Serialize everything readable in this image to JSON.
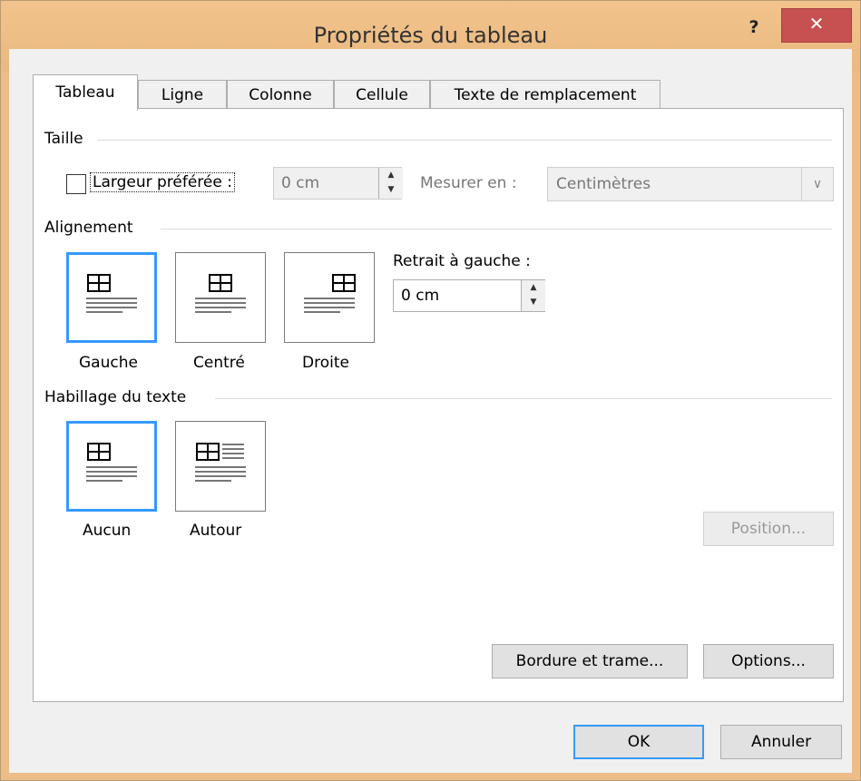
{
  "title": "Propriétés du tableau",
  "help_glyph": "?",
  "close_glyph": "✕",
  "tabs": [
    "Tableau",
    "Ligne",
    "Colonne",
    "Cellule",
    "Texte de remplacement"
  ],
  "taille": {
    "section": "Taille",
    "pref_width_label": "Largeur préférée :",
    "pref_width_value": "0 cm",
    "measure_label": "Mesurer en :",
    "measure_value": "Centimètres"
  },
  "alignement": {
    "section": "Alignement",
    "options": [
      "Gauche",
      "Centré",
      "Droite"
    ],
    "indent_label": "Retrait à gauche :",
    "indent_value": "0 cm"
  },
  "habillage": {
    "section": "Habillage du texte",
    "options": [
      "Aucun",
      "Autour"
    ]
  },
  "buttons": {
    "position": "Position...",
    "borders": "Bordure et trame...",
    "options": "Options...",
    "ok": "OK",
    "cancel": "Annuler"
  }
}
